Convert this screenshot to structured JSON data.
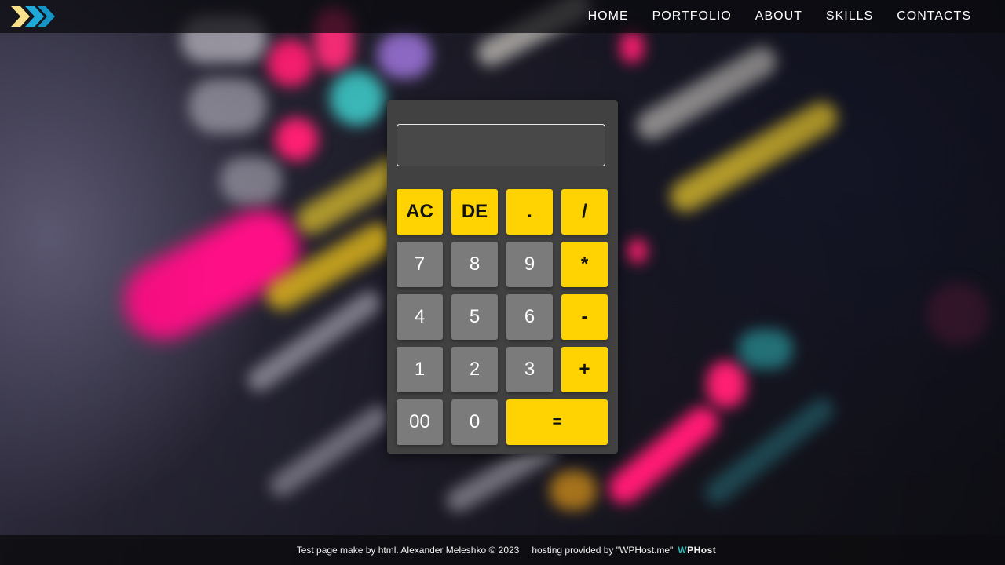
{
  "header": {
    "nav": [
      {
        "label": "HOME"
      },
      {
        "label": "PORTFOLIO"
      },
      {
        "label": "ABOUT"
      },
      {
        "label": "SKILLS"
      },
      {
        "label": "CONTACTS"
      }
    ]
  },
  "calculator": {
    "display_value": "",
    "keys": [
      {
        "label": "AC",
        "kind": "op"
      },
      {
        "label": "DE",
        "kind": "op"
      },
      {
        "label": ".",
        "kind": "op"
      },
      {
        "label": "/",
        "kind": "op"
      },
      {
        "label": "7",
        "kind": "num"
      },
      {
        "label": "8",
        "kind": "num"
      },
      {
        "label": "9",
        "kind": "num"
      },
      {
        "label": "*",
        "kind": "op"
      },
      {
        "label": "4",
        "kind": "num"
      },
      {
        "label": "5",
        "kind": "num"
      },
      {
        "label": "6",
        "kind": "num"
      },
      {
        "label": "-",
        "kind": "op"
      },
      {
        "label": "1",
        "kind": "num"
      },
      {
        "label": "2",
        "kind": "num"
      },
      {
        "label": "3",
        "kind": "num"
      },
      {
        "label": "+",
        "kind": "op"
      },
      {
        "label": "00",
        "kind": "num"
      },
      {
        "label": "0",
        "kind": "num"
      },
      {
        "label": "=",
        "kind": "op"
      }
    ]
  },
  "footer": {
    "credit": "Test page make by html. Alexander Meleshko © 2023",
    "hosting": "hosting provided by \"WPHost.me\"",
    "host_logo_w": "W",
    "host_logo_rest": "PHost"
  },
  "colors": {
    "accent_yellow": "#ffd302",
    "key_gray": "#7b7b7b",
    "panel": "#414141",
    "logo_yellow": "#f7e08a",
    "logo_blue": "#1ea9d8"
  },
  "icons": {
    "logo": "double-chevron-logo"
  }
}
